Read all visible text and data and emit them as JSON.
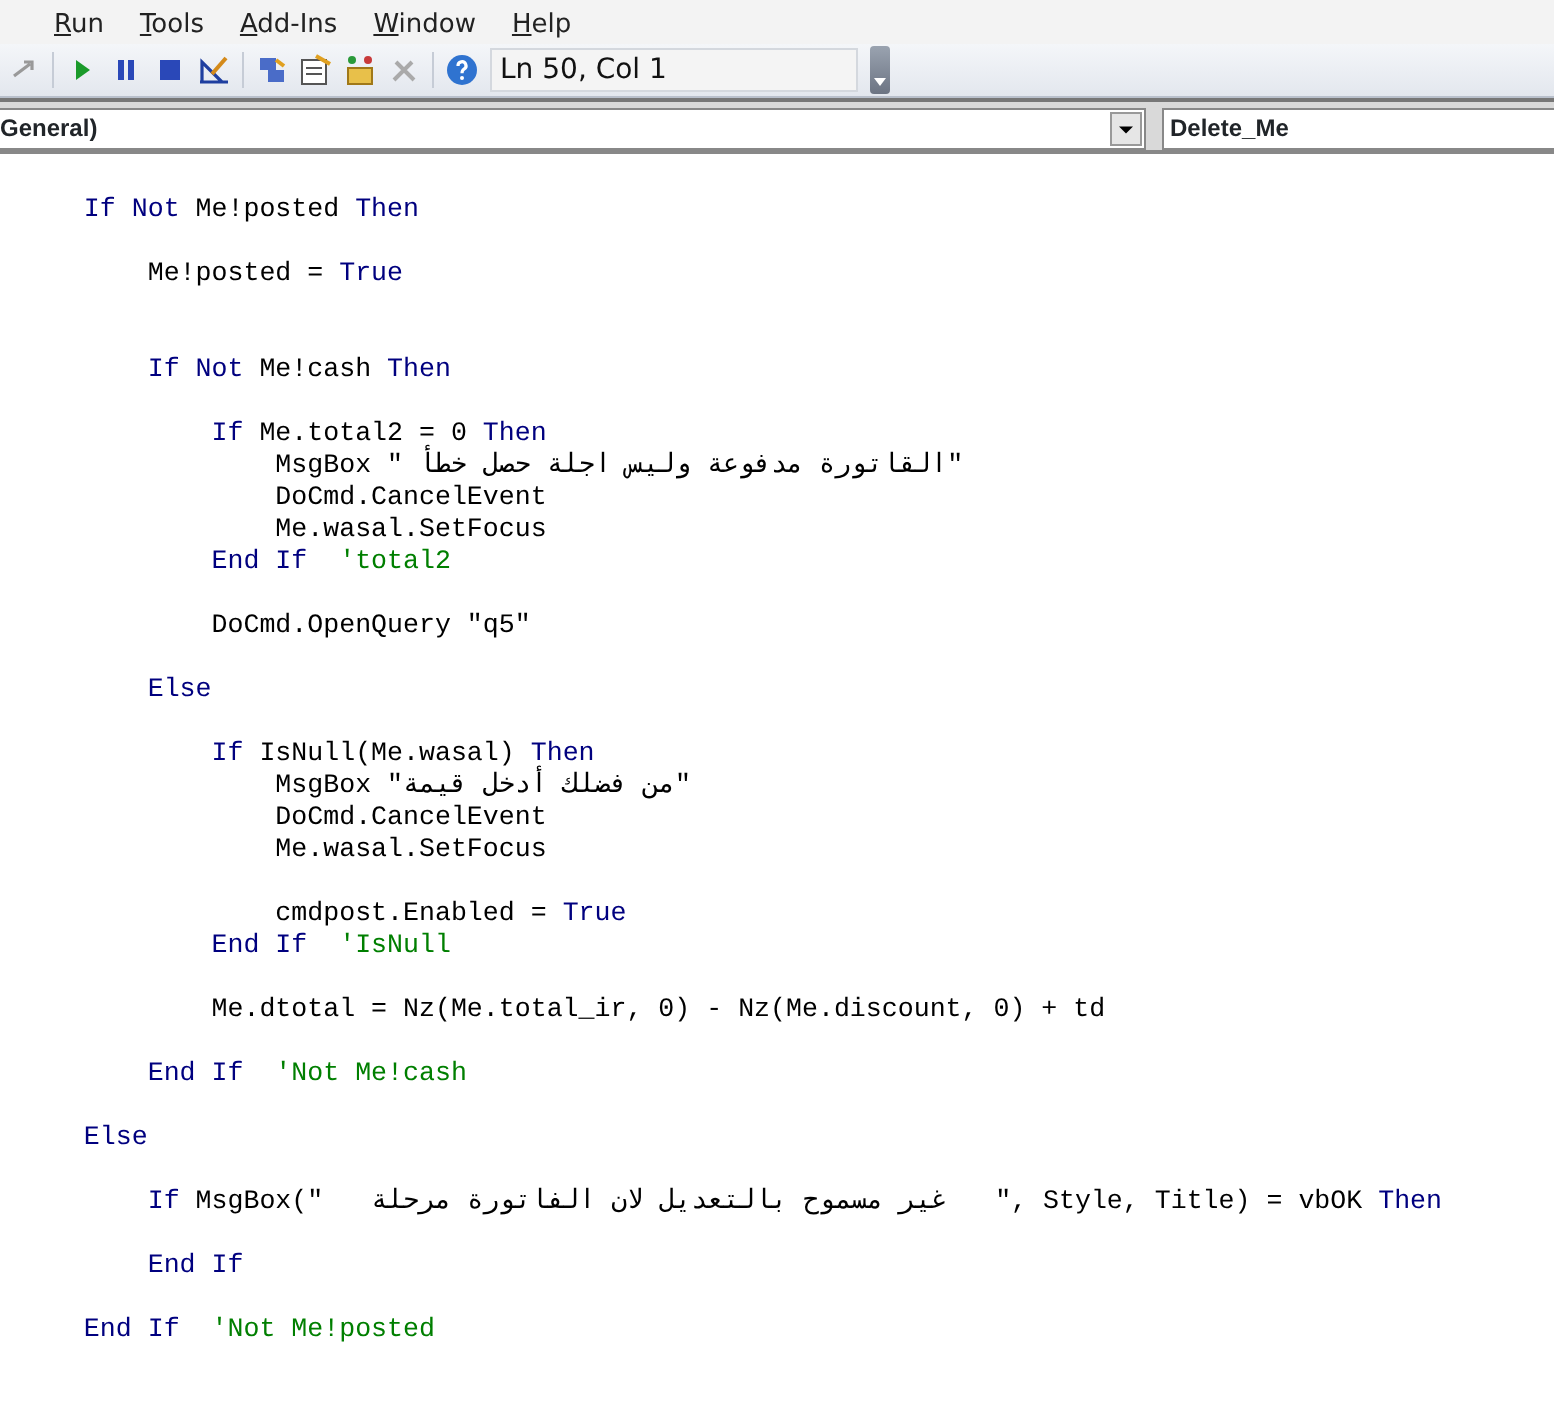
{
  "menu": [
    {
      "label": "Run"
    },
    {
      "label": "Tools"
    },
    {
      "label": "Add-Ins"
    },
    {
      "label": "Window"
    },
    {
      "label": "Help"
    }
  ],
  "toolbar": {
    "position": "Ln 50, Col 1"
  },
  "object_combo": {
    "value": "General)"
  },
  "procedure_combo": {
    "value": "Delete_Me"
  },
  "code": [
    {
      "kind": "blank"
    },
    {
      "kind": "code",
      "segments": [
        {
          "kind": "keyword",
          "text": "    If Not"
        },
        {
          "kind": "plain",
          "text": " Me!posted "
        },
        {
          "kind": "keyword",
          "text": "Then"
        }
      ]
    },
    {
      "kind": "blank"
    },
    {
      "kind": "code",
      "segments": [
        {
          "kind": "plain",
          "text": "        Me!posted = "
        },
        {
          "kind": "keyword",
          "text": "True"
        }
      ]
    },
    {
      "kind": "blank"
    },
    {
      "kind": "blank"
    },
    {
      "kind": "code",
      "segments": [
        {
          "kind": "keyword",
          "text": "        If Not"
        },
        {
          "kind": "plain",
          "text": " Me!cash "
        },
        {
          "kind": "keyword",
          "text": "Then"
        }
      ]
    },
    {
      "kind": "blank"
    },
    {
      "kind": "code",
      "segments": [
        {
          "kind": "keyword",
          "text": "            If"
        },
        {
          "kind": "plain",
          "text": " Me.total2 = 0 "
        },
        {
          "kind": "keyword",
          "text": "Then"
        }
      ]
    },
    {
      "kind": "code",
      "segments": [
        {
          "kind": "plain",
          "text": "                MsgBox \" القاتورة مدفوعة وليس اجلة حصل خطأ\""
        }
      ]
    },
    {
      "kind": "code",
      "segments": [
        {
          "kind": "plain",
          "text": "                DoCmd.CancelEvent"
        }
      ]
    },
    {
      "kind": "code",
      "segments": [
        {
          "kind": "plain",
          "text": "                Me.wasal.SetFocus"
        }
      ]
    },
    {
      "kind": "code",
      "segments": [
        {
          "kind": "keyword",
          "text": "            End If"
        },
        {
          "kind": "comment",
          "text": "  'total2"
        }
      ]
    },
    {
      "kind": "blank"
    },
    {
      "kind": "code",
      "segments": [
        {
          "kind": "plain",
          "text": "            DoCmd.OpenQuery \"q5\""
        }
      ]
    },
    {
      "kind": "blank"
    },
    {
      "kind": "code",
      "segments": [
        {
          "kind": "keyword",
          "text": "        Else"
        }
      ]
    },
    {
      "kind": "blank"
    },
    {
      "kind": "code",
      "segments": [
        {
          "kind": "keyword",
          "text": "            If"
        },
        {
          "kind": "plain",
          "text": " IsNull(Me.wasal) "
        },
        {
          "kind": "keyword",
          "text": "Then"
        }
      ]
    },
    {
      "kind": "code",
      "segments": [
        {
          "kind": "plain",
          "text": "                MsgBox \"من فضلك أدخل قيمة\""
        }
      ]
    },
    {
      "kind": "code",
      "segments": [
        {
          "kind": "plain",
          "text": "                DoCmd.CancelEvent"
        }
      ]
    },
    {
      "kind": "code",
      "segments": [
        {
          "kind": "plain",
          "text": "                Me.wasal.SetFocus"
        }
      ]
    },
    {
      "kind": "blank"
    },
    {
      "kind": "code",
      "segments": [
        {
          "kind": "plain",
          "text": "                cmdpost.Enabled = "
        },
        {
          "kind": "keyword",
          "text": "True"
        }
      ]
    },
    {
      "kind": "code",
      "segments": [
        {
          "kind": "keyword",
          "text": "            End If"
        },
        {
          "kind": "comment",
          "text": "  'IsNull"
        }
      ]
    },
    {
      "kind": "blank"
    },
    {
      "kind": "code",
      "segments": [
        {
          "kind": "plain",
          "text": "            Me.dtotal = Nz(Me.total_ir, 0) - Nz(Me.discount, 0) + td"
        }
      ]
    },
    {
      "kind": "blank"
    },
    {
      "kind": "code",
      "segments": [
        {
          "kind": "keyword",
          "text": "        End If"
        },
        {
          "kind": "comment",
          "text": "  'Not Me!cash"
        }
      ]
    },
    {
      "kind": "blank"
    },
    {
      "kind": "code",
      "segments": [
        {
          "kind": "keyword",
          "text": "    Else"
        }
      ]
    },
    {
      "kind": "blank"
    },
    {
      "kind": "code",
      "segments": [
        {
          "kind": "keyword",
          "text": "        If"
        },
        {
          "kind": "plain",
          "text": " MsgBox(\"   غير مسموح بالتعديل لان الفاتورة مرحلة   \", Style, Title) = vbOK "
        },
        {
          "kind": "keyword",
          "text": "Then"
        }
      ]
    },
    {
      "kind": "blank"
    },
    {
      "kind": "code",
      "segments": [
        {
          "kind": "keyword",
          "text": "        End If"
        }
      ]
    },
    {
      "kind": "blank"
    },
    {
      "kind": "code",
      "segments": [
        {
          "kind": "keyword",
          "text": "    End If"
        },
        {
          "kind": "comment",
          "text": "  'Not Me!posted"
        }
      ]
    }
  ]
}
